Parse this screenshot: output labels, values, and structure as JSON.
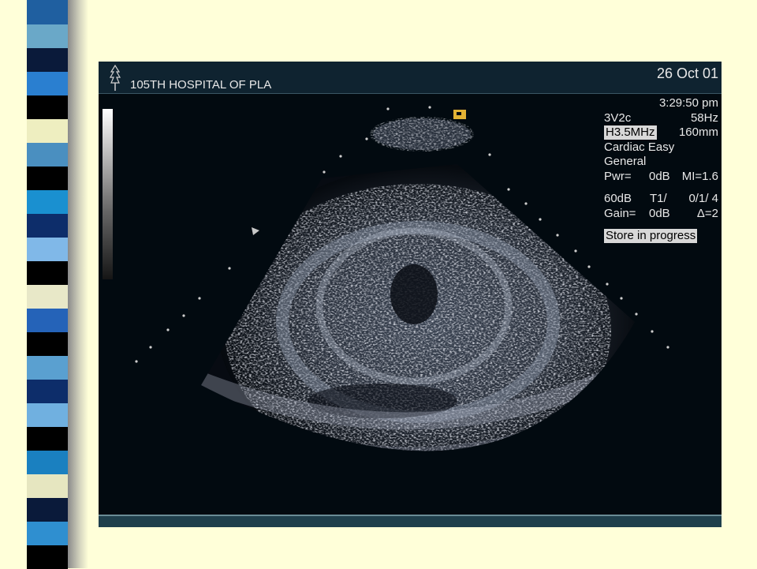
{
  "slide": {
    "background": "#ffffd9",
    "strip_colors": [
      "#1f5fa0",
      "#6aa8c8",
      "#0a1a3a",
      "#2a7fd0",
      "#000000",
      "#eeeec0",
      "#4a8fc0",
      "#000000",
      "#1a90d0",
      "#0d2d6a",
      "#80b8e8",
      "#000000",
      "#e8e8c8",
      "#2563b8",
      "#000000",
      "#5aa0d0",
      "#0d2d6a",
      "#70b0e0",
      "#000000",
      "#1a80c0",
      "#e6e6c0",
      "#0a1a3a",
      "#2f8fd0",
      "#000000"
    ]
  },
  "ultrasound": {
    "hospital": "105TH HOSPITAL OF PLA",
    "date": "26 Oct 01",
    "time": "3:29:50 pm",
    "params": {
      "probe": "3V2c",
      "frame_rate": "58Hz",
      "frequency": "H3.5MHz",
      "depth": "160mm",
      "preset": "Cardiac Easy",
      "mode": "General",
      "power": "Pwr=",
      "power_val": "0dB",
      "mi": "MI=1.6",
      "dynamic_range": "60dB",
      "tissue": "T1/",
      "tissue_val": "0/1/ 4",
      "gain": "Gain=",
      "gain_val": "0dB",
      "delta": "Δ=2",
      "status": "Store in progress"
    },
    "icons": {
      "logo": "tree-logo-icon",
      "marker": "orientation-marker-icon"
    },
    "colors": {
      "panel": "#020a10",
      "header": "#0f2330",
      "text": "#e8e8e8",
      "marker": "#e3b234"
    }
  }
}
